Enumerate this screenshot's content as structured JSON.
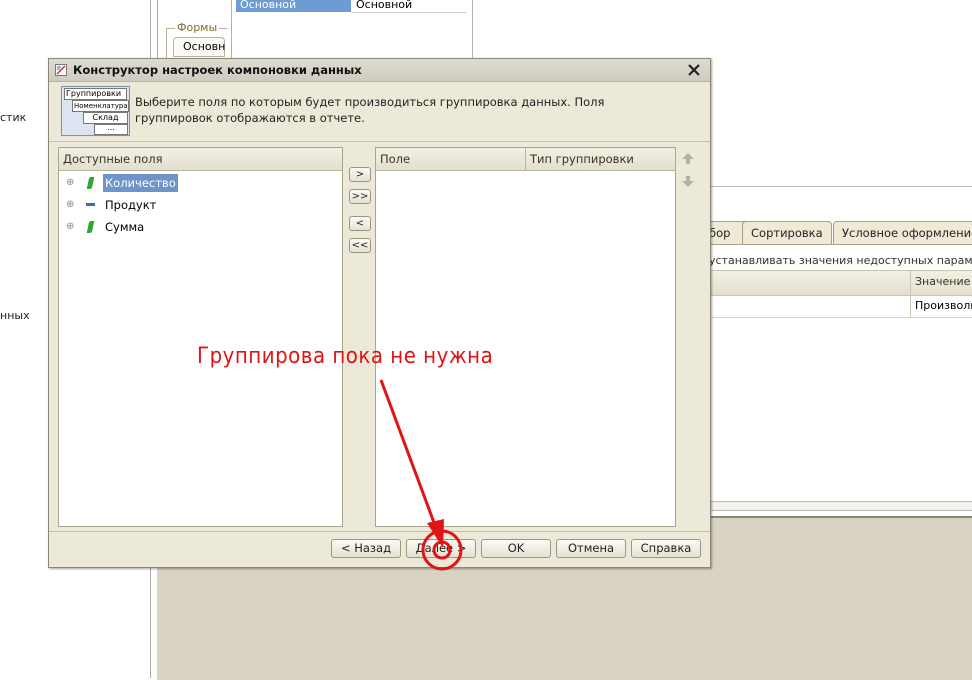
{
  "background": {
    "left_labels": [
      "стик",
      "нных"
    ],
    "forms_group": "Формы",
    "forms_tab": "Основн",
    "table_cells": [
      "Основной",
      "Основной"
    ],
    "tabs": [
      "бор",
      "Сортировка",
      "Условное оформление"
    ],
    "hint": "устанавливать значения недоступных параметро",
    "grid_header": "Значение",
    "grid_cell": "Произволь"
  },
  "dialog": {
    "title": "Конструктор настроек компоновки данных",
    "description": "Выберите поля по которым будет производиться группировка данных. Поля группировок отображаются в отчете.",
    "illustration_labels": [
      "Группировки",
      "Номенклатура",
      "Склад",
      "..."
    ],
    "available_fields": {
      "header": "Доступные поля",
      "items": [
        {
          "label": "Количество",
          "icon": "numeric-field-icon",
          "selected": true
        },
        {
          "label": "Продукт",
          "icon": "dimension-field-icon",
          "selected": false
        },
        {
          "label": "Сумма",
          "icon": "numeric-field-icon",
          "selected": false
        }
      ]
    },
    "move_buttons": [
      ">",
      ">>",
      "<",
      "<<"
    ],
    "grouping_table": {
      "columns": [
        "Поле",
        "Тип группировки"
      ]
    },
    "buttons": {
      "back": "< Назад",
      "next": "Далее >",
      "ok": "OK",
      "cancel": "Отмена",
      "help": "Справка"
    }
  },
  "annotation": {
    "text": "Группирова пока не нужна",
    "color": "#e01414"
  }
}
